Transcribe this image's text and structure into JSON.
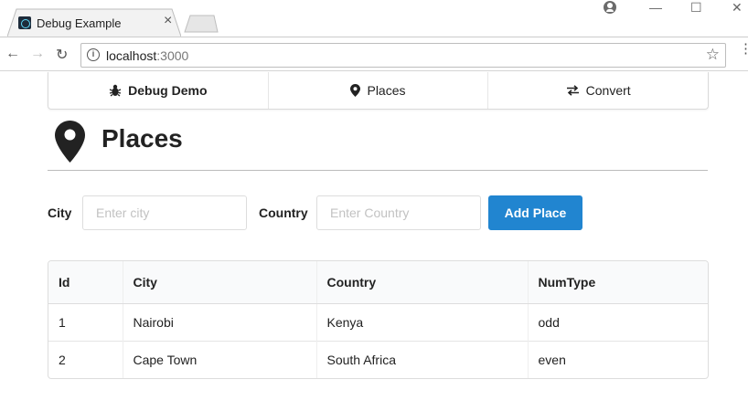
{
  "browser": {
    "tab_title": "Debug Example",
    "tab_close": "×",
    "url_host": "localhost",
    "url_port": ":3000",
    "window_controls": {
      "minimize": "—",
      "maximize": "☐",
      "close": "✕"
    },
    "nav": {
      "back": "←",
      "forward": "→",
      "reload": "↻"
    },
    "info_icon": "i",
    "star_icon": "☆",
    "menu_icon": "⋮"
  },
  "app_nav": {
    "items": [
      {
        "label": "Debug Demo",
        "icon": "bug-icon"
      },
      {
        "label": "Places",
        "icon": "map-marker-icon"
      },
      {
        "label": "Convert",
        "icon": "exchange-icon"
      }
    ]
  },
  "header": {
    "title": "Places",
    "icon": "map-marker-icon"
  },
  "form": {
    "city_label": "City",
    "city_placeholder": "Enter city",
    "city_value": "",
    "country_label": "Country",
    "country_placeholder": "Enter Country",
    "country_value": "",
    "add_button": "Add Place",
    "button_color": "#2185d0"
  },
  "table": {
    "columns": [
      "Id",
      "City",
      "Country",
      "NumType"
    ],
    "rows": [
      [
        "1",
        "Nairobi",
        "Kenya",
        "odd"
      ],
      [
        "2",
        "Cape Town",
        "South Africa",
        "even"
      ]
    ]
  }
}
